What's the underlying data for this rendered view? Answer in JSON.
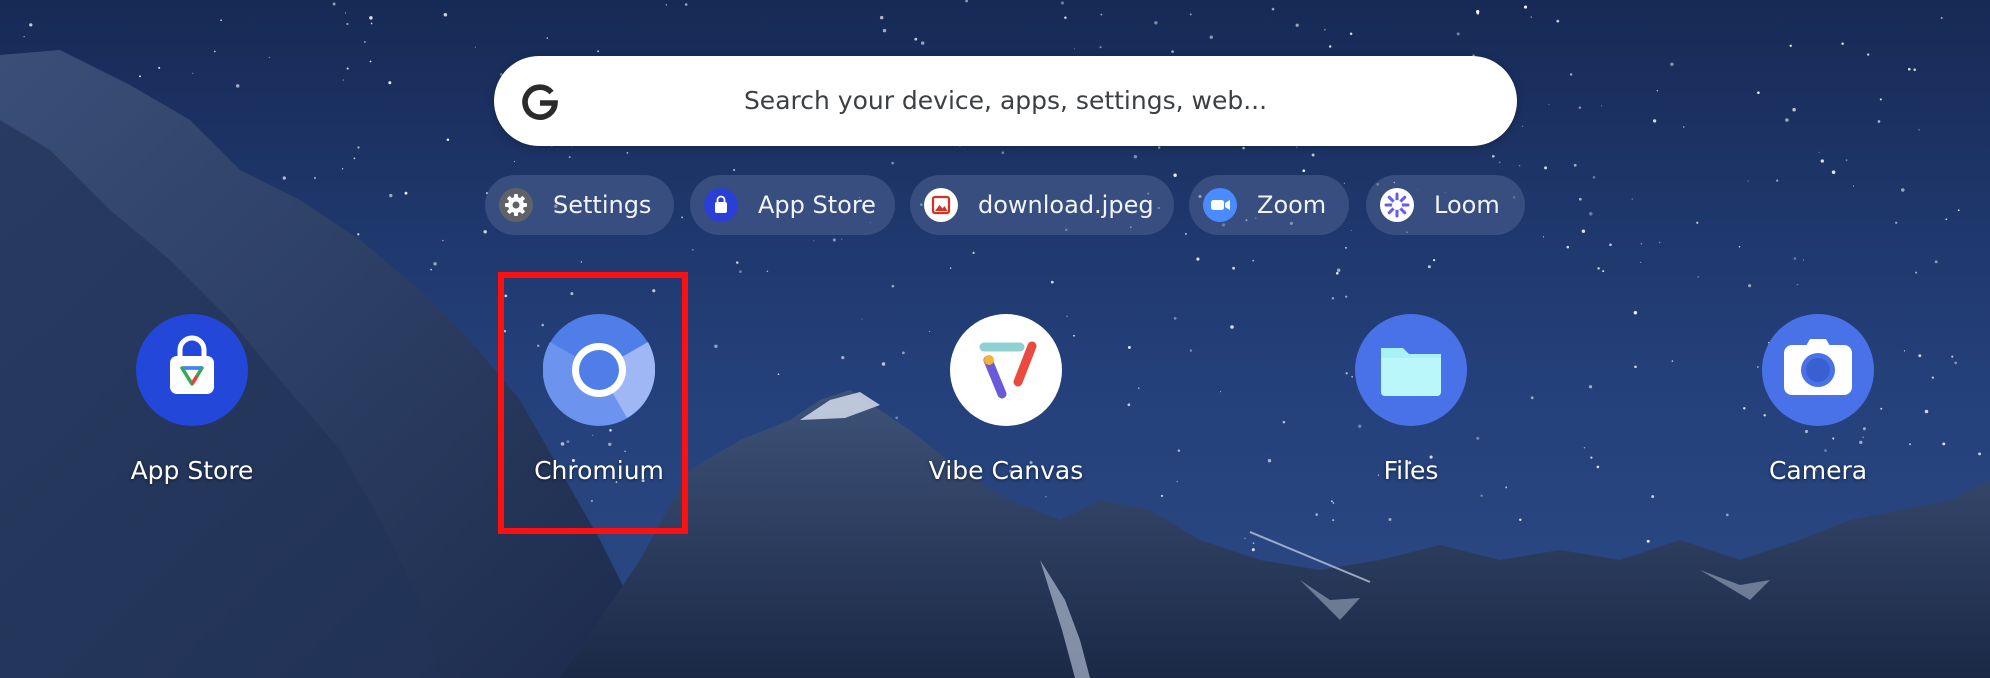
{
  "search": {
    "placeholder": "Search your device, apps, settings, web...",
    "icon": "google-g-icon"
  },
  "suggestions": [
    {
      "label": "Settings",
      "icon": "gear-icon"
    },
    {
      "label": "App Store",
      "icon": "app-store-bag-icon"
    },
    {
      "label": "download.jpeg",
      "icon": "image-file-icon"
    },
    {
      "label": "Zoom",
      "icon": "zoom-camera-icon"
    },
    {
      "label": "Loom",
      "icon": "loom-icon"
    }
  ],
  "apps": [
    {
      "label": "App Store",
      "icon": "app-store-icon"
    },
    {
      "label": "Chromium",
      "icon": "chromium-icon",
      "highlighted": true
    },
    {
      "label": "Vibe Canvas",
      "icon": "vibe-canvas-icon"
    },
    {
      "label": "Files",
      "icon": "folder-icon"
    },
    {
      "label": "Camera",
      "icon": "camera-icon"
    }
  ],
  "colors": {
    "highlight": "#ff1010",
    "accent": "#4a72e8",
    "chip_background": "#4f6391"
  }
}
